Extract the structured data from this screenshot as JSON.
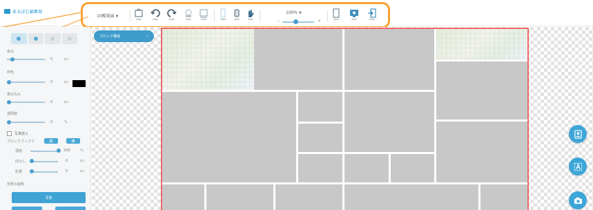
{
  "app": {
    "title": "あるばむ編集部"
  },
  "toolbar": {
    "font_select": "10枚見出",
    "zoom_label": "100%",
    "zoom_fraction": 0.42,
    "icons": [
      "template-icon",
      "undo-icon",
      "redo-icon",
      "frame-icon",
      "layout-icon",
      "page-icon",
      "portrait-icon",
      "hand-icon",
      "single-page-icon",
      "preview-icon",
      "exit-icon"
    ]
  },
  "left_panel": {
    "tabs": [
      "tab-layout",
      "tab-color",
      "tab-text",
      "tab-image"
    ],
    "rows": [
      {
        "label": "余白",
        "value": "5",
        "unit": "px",
        "fraction": 0.15
      },
      {
        "label": "枠色",
        "value": "0",
        "unit": "px",
        "fraction": 0.05
      },
      {
        "label": "角の丸み",
        "value": "0",
        "unit": "px",
        "fraction": 0.05
      },
      {
        "label": "透明度",
        "value": "0",
        "unit": "%",
        "fraction": 0.05
      }
    ],
    "checkbox_label": "写真揃え",
    "align_label": "ブロックブックマ",
    "align_buttons": [
      "縦",
      "横"
    ],
    "image_rows": [
      {
        "label": "濃度",
        "value": "100",
        "unit": "%",
        "fraction": 1.0
      },
      {
        "label": "ぼかし",
        "value": "0",
        "unit": "px",
        "fraction": 0.05
      },
      {
        "label": "影量",
        "value": "0",
        "unit": "px",
        "fraction": 0.05
      }
    ],
    "bg_label": "背景の画像",
    "big_button": "写真"
  },
  "canvas": {
    "block_pill": "ブロック構成",
    "colors": {
      "border": "#ee6a6a",
      "cell": "#c8c8c8",
      "accent": "#3fa3d4",
      "toolbar_highlight": "#f7a030"
    }
  },
  "fabs": [
    "portrait-fab-icon",
    "text-fab-icon",
    "camera-fab-icon"
  ]
}
